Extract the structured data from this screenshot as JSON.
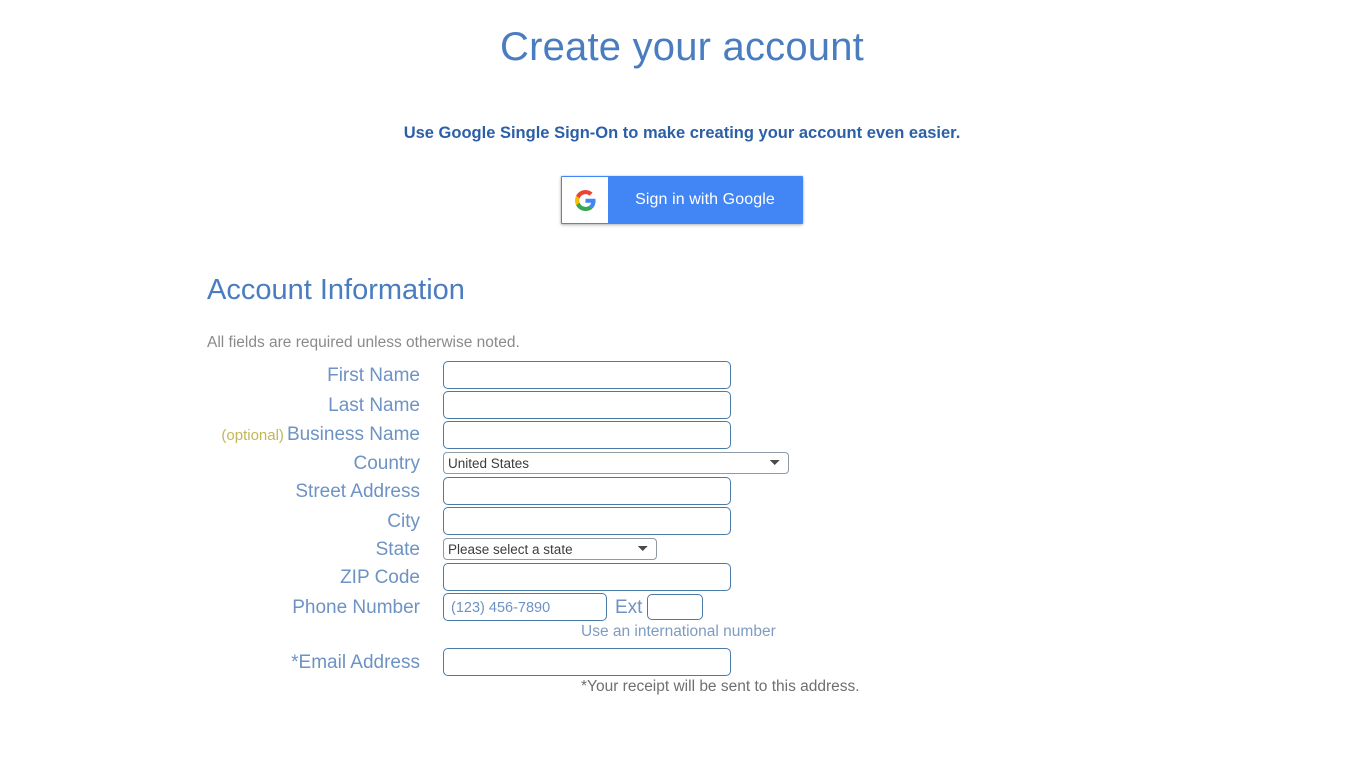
{
  "page": {
    "title": "Create your account"
  },
  "sso": {
    "promo_text": "Use Google Single Sign-On to make creating your account even easier.",
    "button_label": "Sign in with Google",
    "icon": "google-g-icon",
    "button_color": "#4285f4"
  },
  "account_section": {
    "heading": "Account Information",
    "note": "All fields are required unless otherwise noted."
  },
  "colors": {
    "heading_blue": "#4a7dc0",
    "label_blue": "#6d93c4",
    "input_border": "#4a7ba8",
    "optional_olive": "#c3b657",
    "note_gray": "#8a8a8a",
    "google_blue": "#4285f4"
  },
  "fields": {
    "first_name": {
      "label": "First Name",
      "value": "",
      "placeholder": ""
    },
    "last_name": {
      "label": "Last Name",
      "value": "",
      "placeholder": ""
    },
    "business_name": {
      "optional_tag": "(optional)",
      "label": "Business Name",
      "value": "",
      "placeholder": ""
    },
    "country": {
      "label": "Country",
      "selected": "United States",
      "options": [
        "United States"
      ]
    },
    "street_address": {
      "label": "Street Address",
      "value": "",
      "placeholder": ""
    },
    "city": {
      "label": "City",
      "value": "",
      "placeholder": ""
    },
    "state": {
      "label": "State",
      "selected": "Please select a state",
      "options": [
        "Please select a state"
      ]
    },
    "zip_code": {
      "label": "ZIP Code",
      "value": "",
      "placeholder": ""
    },
    "phone_number": {
      "label": "Phone Number",
      "value": "",
      "placeholder": "(123) 456-7890",
      "ext_label": "Ext",
      "ext_value": "",
      "helper_link": "Use an international number"
    },
    "email_address": {
      "label": "*Email Address",
      "value": "",
      "placeholder": "",
      "helper_note": "*Your receipt will be sent to this address."
    }
  }
}
